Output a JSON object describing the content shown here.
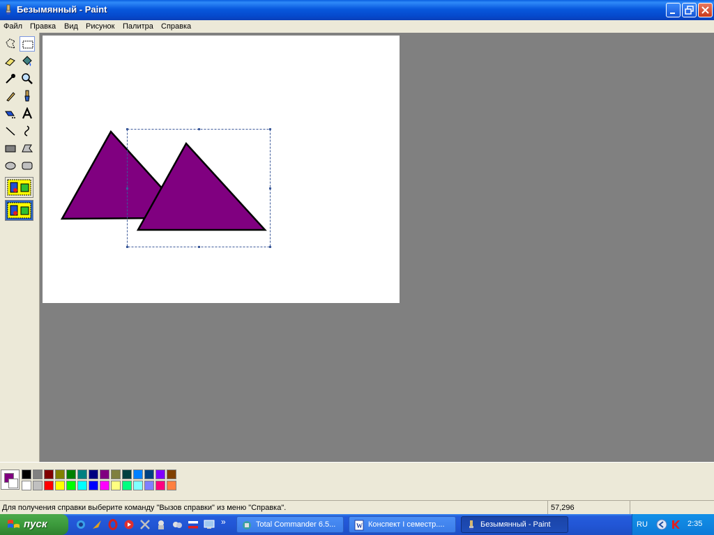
{
  "window": {
    "title": "Безымянный - Paint",
    "icon": "paint-brush-icon"
  },
  "menu": {
    "items": [
      "Файл",
      "Правка",
      "Вид",
      "Рисунок",
      "Палитра",
      "Справка"
    ]
  },
  "toolbox": {
    "tools": [
      {
        "name": "free-select-icon"
      },
      {
        "name": "rect-select-icon",
        "active": true
      },
      {
        "name": "eraser-icon"
      },
      {
        "name": "fill-icon"
      },
      {
        "name": "color-picker-icon"
      },
      {
        "name": "magnifier-icon"
      },
      {
        "name": "pencil-icon"
      },
      {
        "name": "brush-icon"
      },
      {
        "name": "airbrush-icon"
      },
      {
        "name": "text-icon"
      },
      {
        "name": "line-icon"
      },
      {
        "name": "curve-icon"
      },
      {
        "name": "rectangle-icon"
      },
      {
        "name": "polygon-icon"
      },
      {
        "name": "ellipse-icon"
      },
      {
        "name": "rounded-rect-icon"
      }
    ]
  },
  "colors": {
    "foreground": "#800080",
    "background": "#ffffff",
    "accent_selection": "#316ac5",
    "palette_row1": [
      "#000000",
      "#808080",
      "#800000",
      "#808000",
      "#008000",
      "#008080",
      "#000080",
      "#800080",
      "#808040",
      "#004040",
      "#0080ff",
      "#004080",
      "#8000ff",
      "#804000"
    ],
    "palette_row2": [
      "#ffffff",
      "#c0c0c0",
      "#ff0000",
      "#ffff00",
      "#00ff00",
      "#00ffff",
      "#0000ff",
      "#ff00ff",
      "#ffff80",
      "#00ff80",
      "#80ffff",
      "#8080ff",
      "#ff0080",
      "#ff8040"
    ]
  },
  "status": {
    "help_text": "Для получения справки выберите команду \"Вызов справки\" из меню \"Справка\".",
    "coords": "57,296"
  },
  "taskbar": {
    "start_label": "пуск",
    "quick_launch": [
      "ie-icon",
      "winamp-icon",
      "opera-icon",
      "media-icon",
      "tools-icon",
      "mascot-icon",
      "explorer-icon",
      "flag-icon",
      "desktop-icon"
    ],
    "quick_launch_more": "»",
    "tasks": [
      {
        "label": "Total Commander 6.5...",
        "icon": "total-commander-icon",
        "active": false
      },
      {
        "label": "Конспект I семестр....",
        "icon": "word-icon",
        "active": false
      },
      {
        "label": "Безымянный - Paint",
        "icon": "paint-brush-icon",
        "active": true
      }
    ],
    "tray": {
      "language": "RU",
      "clock": "2:35",
      "icons": [
        "back-icon",
        "kaspersky-icon"
      ]
    }
  }
}
